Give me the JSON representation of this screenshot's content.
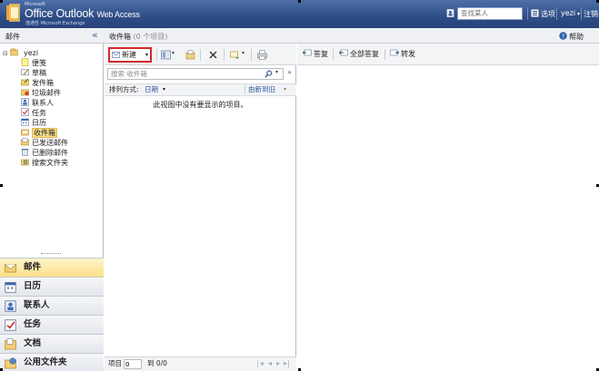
{
  "header": {
    "brand_top": "Microsoft",
    "product": "Office Outlook",
    "product_suffix": "Web Access",
    "subtitle": "连通性 Microsoft Exchange",
    "search_people_placeholder": "查找某人",
    "options_label": "选项",
    "user_label": "yezi",
    "logout_label": "注销"
  },
  "subbar": {
    "left_title": "邮件",
    "collapse_glyph": "«",
    "folder_title": "收件箱",
    "folder_count": "(0 个项目)",
    "help_label": "帮助"
  },
  "tree": {
    "root": "yezi",
    "items": [
      {
        "label": "便笺",
        "icon": "note-icon"
      },
      {
        "label": "草稿",
        "icon": "draft-icon"
      },
      {
        "label": "发件箱",
        "icon": "outbox-icon"
      },
      {
        "label": "垃圾邮件",
        "icon": "junk-icon"
      },
      {
        "label": "联系人",
        "icon": "contacts-icon"
      },
      {
        "label": "任务",
        "icon": "tasks-icon"
      },
      {
        "label": "日历",
        "icon": "calendar-icon"
      },
      {
        "label": "收件箱",
        "icon": "inbox-icon",
        "selected": true
      },
      {
        "label": "已发送邮件",
        "icon": "sent-icon"
      },
      {
        "label": "已删除邮件",
        "icon": "deleted-icon"
      },
      {
        "label": "搜索文件夹",
        "icon": "search-folder-icon"
      }
    ]
  },
  "nav_buttons": [
    {
      "label": "邮件",
      "icon": "mail-icon",
      "active": true
    },
    {
      "label": "日历",
      "icon": "calendar-icon"
    },
    {
      "label": "联系人",
      "icon": "contacts-icon"
    },
    {
      "label": "任务",
      "icon": "tasks-icon"
    },
    {
      "label": "文档",
      "icon": "documents-icon"
    },
    {
      "label": "公用文件夹",
      "icon": "public-folders-icon"
    }
  ],
  "list": {
    "new_label": "新建",
    "search_placeholder": "搜索 收件箱",
    "sort_by_label": "排列方式:",
    "sort_field": "日期",
    "sort_order": "由新到旧",
    "empty_message": "此视图中没有要显示的项目。",
    "pager_item_label": "项目",
    "pager_item_value": "0",
    "pager_range": "到 0/0"
  },
  "reading": {
    "reply_label": "答复",
    "reply_all_label": "全部答复",
    "forward_label": "转发"
  },
  "colors": {
    "header_blue": "#2e4d86",
    "selection_yellow": "#fbe08a",
    "new_button_outline": "#d22a2a"
  }
}
